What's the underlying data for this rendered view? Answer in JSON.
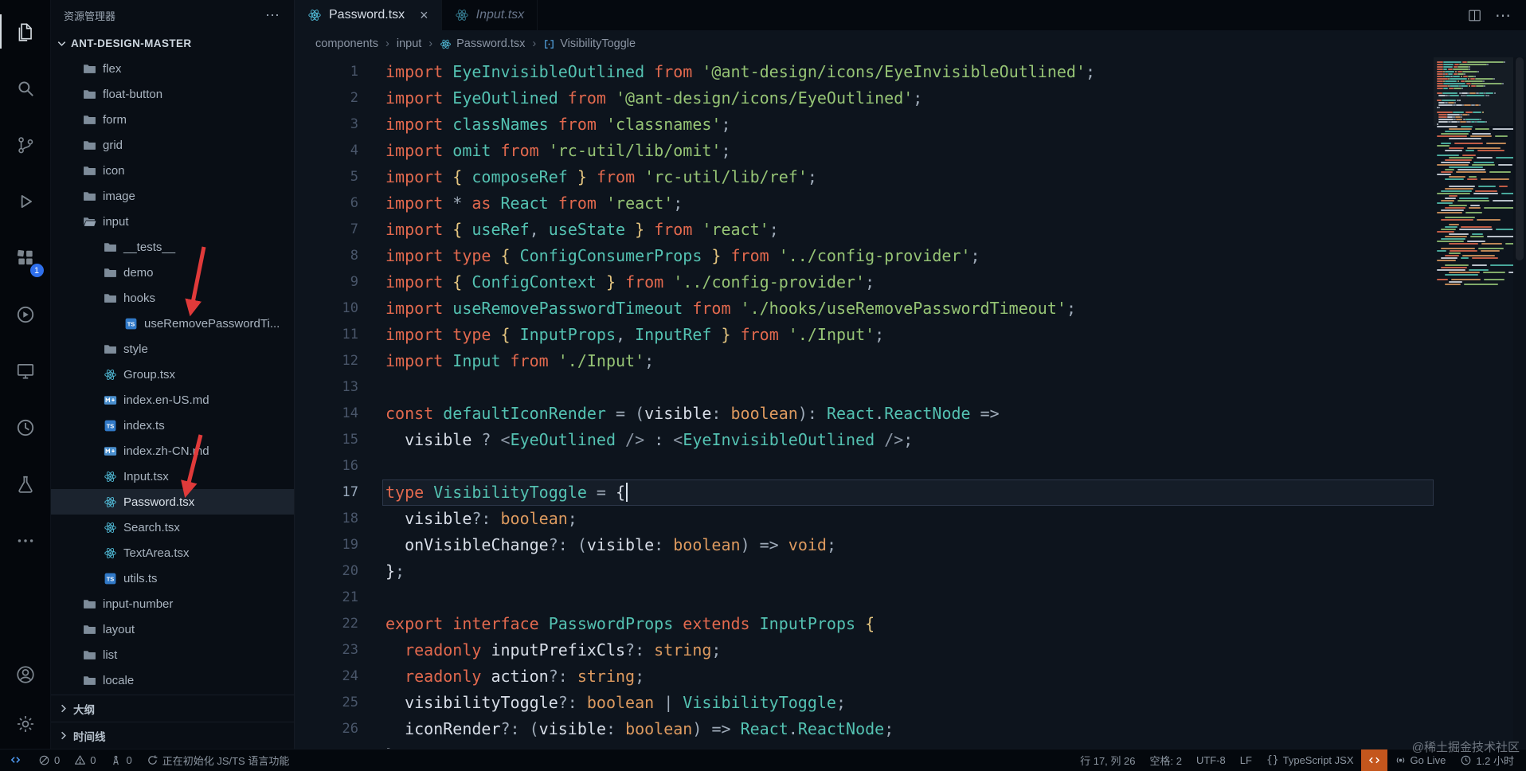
{
  "ui_colors": {
    "badge": "#2f6feb",
    "orange_badge": "#c4561d",
    "annotation_arrow": "#e03a3a",
    "remote_blue": "#4f9cf5",
    "react_icon": "#53c1de"
  },
  "activity_bar": {
    "items": [
      {
        "name": "explorer",
        "active": true
      },
      {
        "name": "search"
      },
      {
        "name": "source-control"
      },
      {
        "name": "run-and-debug"
      },
      {
        "name": "extensions",
        "badge": "1"
      },
      {
        "name": "tool-circle"
      },
      {
        "name": "remote-explorer"
      },
      {
        "name": "history"
      },
      {
        "name": "testing"
      },
      {
        "name": "more"
      }
    ],
    "bottom": [
      {
        "name": "account"
      },
      {
        "name": "settings"
      }
    ]
  },
  "sidebar": {
    "title": "资源管理器",
    "more_label": "⋯",
    "root_label": "ANT-DESIGN-MASTER",
    "tree": [
      {
        "label": "flex",
        "icon": "folder",
        "indent": 1
      },
      {
        "label": "float-button",
        "icon": "folder",
        "indent": 1
      },
      {
        "label": "form",
        "icon": "folder",
        "indent": 1
      },
      {
        "label": "grid",
        "icon": "folder",
        "indent": 1
      },
      {
        "label": "icon",
        "icon": "folder",
        "indent": 1
      },
      {
        "label": "image",
        "icon": "folder",
        "indent": 1
      },
      {
        "label": "input",
        "icon": "folder-open",
        "indent": 1
      },
      {
        "label": "__tests__",
        "icon": "folder",
        "indent": 2
      },
      {
        "label": "demo",
        "icon": "folder",
        "indent": 2
      },
      {
        "label": "hooks",
        "icon": "folder",
        "indent": 2
      },
      {
        "label": "useRemovePasswordTi...",
        "icon": "ts",
        "indent": 3
      },
      {
        "label": "style",
        "icon": "folder",
        "indent": 2
      },
      {
        "label": "Group.tsx",
        "icon": "react",
        "indent": 2
      },
      {
        "label": "index.en-US.md",
        "icon": "md",
        "indent": 2
      },
      {
        "label": "index.ts",
        "icon": "ts",
        "indent": 2
      },
      {
        "label": "index.zh-CN.md",
        "icon": "md",
        "indent": 2
      },
      {
        "label": "Input.tsx",
        "icon": "react",
        "indent": 2
      },
      {
        "label": "Password.tsx",
        "icon": "react",
        "indent": 2,
        "selected": true
      },
      {
        "label": "Search.tsx",
        "icon": "react",
        "indent": 2
      },
      {
        "label": "TextArea.tsx",
        "icon": "react",
        "indent": 2
      },
      {
        "label": "utils.ts",
        "icon": "ts",
        "indent": 2
      },
      {
        "label": "input-number",
        "icon": "folder",
        "indent": 1
      },
      {
        "label": "layout",
        "icon": "folder",
        "indent": 1
      },
      {
        "label": "list",
        "icon": "folder",
        "indent": 1
      },
      {
        "label": "locale",
        "icon": "folder",
        "indent": 1
      }
    ],
    "annotation_arrows": [
      {
        "from": "192 310",
        "to": "176 390"
      },
      {
        "from": "188 546",
        "to": "170 618"
      }
    ],
    "bottom_sections": [
      {
        "label": "大纲",
        "name": "outline-section"
      },
      {
        "label": "时间线",
        "name": "timeline-section"
      }
    ]
  },
  "editor": {
    "tabs": [
      {
        "label": "Password.tsx",
        "icon": "react",
        "active": true,
        "close_label": "×"
      },
      {
        "label": "Input.tsx",
        "icon": "react",
        "italic": true
      }
    ],
    "breadcrumbs": [
      {
        "label": "components"
      },
      {
        "label": "input"
      },
      {
        "label": "Password.tsx",
        "icon": "react"
      },
      {
        "label": "VisibilityToggle",
        "icon": "symbol"
      }
    ],
    "code": {
      "current_line": 17,
      "cursor_line": 17,
      "palette": {
        "kw": "#e2694e",
        "id": "#54c2b2",
        "str": "#96c475",
        "ty": "#dd9a5f",
        "br": "#e3c47f",
        "pu": "#9fabb9",
        "wh": "#d8dee8",
        "ag": "#8a95a3"
      },
      "lines": [
        [
          [
            "kw",
            "import "
          ],
          [
            "id",
            "EyeInvisibleOutlined"
          ],
          [
            "kw",
            " from "
          ],
          [
            "str",
            "'@ant-design/icons/EyeInvisibleOutlined'"
          ],
          [
            "pu",
            ";"
          ]
        ],
        [
          [
            "kw",
            "import "
          ],
          [
            "id",
            "EyeOutlined"
          ],
          [
            "kw",
            " from "
          ],
          [
            "str",
            "'@ant-design/icons/EyeOutlined'"
          ],
          [
            "pu",
            ";"
          ]
        ],
        [
          [
            "kw",
            "import "
          ],
          [
            "id",
            "classNames"
          ],
          [
            "kw",
            " from "
          ],
          [
            "str",
            "'classnames'"
          ],
          [
            "pu",
            ";"
          ]
        ],
        [
          [
            "kw",
            "import "
          ],
          [
            "id",
            "omit"
          ],
          [
            "kw",
            " from "
          ],
          [
            "str",
            "'rc-util/lib/omit'"
          ],
          [
            "pu",
            ";"
          ]
        ],
        [
          [
            "kw",
            "import "
          ],
          [
            "br",
            "{ "
          ],
          [
            "id",
            "composeRef"
          ],
          [
            "br",
            " }"
          ],
          [
            "kw",
            " from "
          ],
          [
            "str",
            "'rc-util/lib/ref'"
          ],
          [
            "pu",
            ";"
          ]
        ],
        [
          [
            "kw",
            "import "
          ],
          [
            "pu",
            "* "
          ],
          [
            "kw",
            "as "
          ],
          [
            "id",
            "React"
          ],
          [
            "kw",
            " from "
          ],
          [
            "str",
            "'react'"
          ],
          [
            "pu",
            ";"
          ]
        ],
        [
          [
            "kw",
            "import "
          ],
          [
            "br",
            "{ "
          ],
          [
            "id",
            "useRef"
          ],
          [
            "pu",
            ", "
          ],
          [
            "id",
            "useState"
          ],
          [
            "br",
            " }"
          ],
          [
            "kw",
            " from "
          ],
          [
            "str",
            "'react'"
          ],
          [
            "pu",
            ";"
          ]
        ],
        [
          [
            "kw",
            "import type "
          ],
          [
            "br",
            "{ "
          ],
          [
            "id",
            "ConfigConsumerProps"
          ],
          [
            "br",
            " }"
          ],
          [
            "kw",
            " from "
          ],
          [
            "str",
            "'../config-provider'"
          ],
          [
            "pu",
            ";"
          ]
        ],
        [
          [
            "kw",
            "import "
          ],
          [
            "br",
            "{ "
          ],
          [
            "id",
            "ConfigContext"
          ],
          [
            "br",
            " }"
          ],
          [
            "kw",
            " from "
          ],
          [
            "str",
            "'../config-provider'"
          ],
          [
            "pu",
            ";"
          ]
        ],
        [
          [
            "kw",
            "import "
          ],
          [
            "id",
            "useRemovePasswordTimeout"
          ],
          [
            "kw",
            " from "
          ],
          [
            "str",
            "'./hooks/useRemovePasswordTimeout'"
          ],
          [
            "pu",
            ";"
          ]
        ],
        [
          [
            "kw",
            "import type "
          ],
          [
            "br",
            "{ "
          ],
          [
            "id",
            "InputProps"
          ],
          [
            "pu",
            ", "
          ],
          [
            "id",
            "InputRef"
          ],
          [
            "br",
            " }"
          ],
          [
            "kw",
            " from "
          ],
          [
            "str",
            "'./Input'"
          ],
          [
            "pu",
            ";"
          ]
        ],
        [
          [
            "kw",
            "import "
          ],
          [
            "id",
            "Input"
          ],
          [
            "kw",
            " from "
          ],
          [
            "str",
            "'./Input'"
          ],
          [
            "pu",
            ";"
          ]
        ],
        [],
        [
          [
            "kw",
            "const "
          ],
          [
            "id",
            "defaultIconRender"
          ],
          [
            "pu",
            " = ("
          ],
          [
            "wh",
            "visible"
          ],
          [
            "pu",
            ": "
          ],
          [
            "ty",
            "boolean"
          ],
          [
            "pu",
            "): "
          ],
          [
            "id",
            "React"
          ],
          [
            "pu",
            "."
          ],
          [
            "id",
            "ReactNode"
          ],
          [
            "pu",
            " =>"
          ]
        ],
        [
          [
            "wh",
            "  visible "
          ],
          [
            "pu",
            "? "
          ],
          [
            "ag",
            "<"
          ],
          [
            "id",
            "EyeOutlined"
          ],
          [
            "ag",
            " /> "
          ],
          [
            "pu",
            ": "
          ],
          [
            "ag",
            "<"
          ],
          [
            "id",
            "EyeInvisibleOutlined"
          ],
          [
            "ag",
            " />"
          ],
          [
            "pu",
            ";"
          ]
        ],
        [],
        [
          [
            "kw",
            "type "
          ],
          [
            "id",
            "VisibilityToggle"
          ],
          [
            "pu",
            " = "
          ],
          [
            "wh",
            "{"
          ]
        ],
        [
          [
            "wh",
            "  visible"
          ],
          [
            "pu",
            "?: "
          ],
          [
            "ty",
            "boolean"
          ],
          [
            "pu",
            ";"
          ]
        ],
        [
          [
            "wh",
            "  onVisibleChange"
          ],
          [
            "pu",
            "?: ("
          ],
          [
            "wh",
            "visible"
          ],
          [
            "pu",
            ": "
          ],
          [
            "ty",
            "boolean"
          ],
          [
            "pu",
            ") => "
          ],
          [
            "ty",
            "void"
          ],
          [
            "pu",
            ";"
          ]
        ],
        [
          [
            "wh",
            "}"
          ],
          [
            "pu",
            ";"
          ]
        ],
        [],
        [
          [
            "kw",
            "export interface "
          ],
          [
            "id",
            "PasswordProps"
          ],
          [
            "kw",
            " extends "
          ],
          [
            "id",
            "InputProps"
          ],
          [
            "br",
            " {"
          ]
        ],
        [
          [
            "kw",
            "  readonly "
          ],
          [
            "wh",
            "inputPrefixCls"
          ],
          [
            "pu",
            "?: "
          ],
          [
            "ty",
            "string"
          ],
          [
            "pu",
            ";"
          ]
        ],
        [
          [
            "kw",
            "  readonly "
          ],
          [
            "wh",
            "action"
          ],
          [
            "pu",
            "?: "
          ],
          [
            "ty",
            "string"
          ],
          [
            "pu",
            ";"
          ]
        ],
        [
          [
            "wh",
            "  visibilityToggle"
          ],
          [
            "pu",
            "?: "
          ],
          [
            "ty",
            "boolean"
          ],
          [
            "pu",
            " | "
          ],
          [
            "id",
            "VisibilityToggle"
          ],
          [
            "pu",
            ";"
          ]
        ],
        [
          [
            "wh",
            "  iconRender"
          ],
          [
            "pu",
            "?: ("
          ],
          [
            "wh",
            "visible"
          ],
          [
            "pu",
            ": "
          ],
          [
            "ty",
            "boolean"
          ],
          [
            "pu",
            ") => "
          ],
          [
            "id",
            "React"
          ],
          [
            "pu",
            "."
          ],
          [
            "id",
            "ReactNode"
          ],
          [
            "pu",
            ";"
          ]
        ],
        [
          [
            "wh",
            "}"
          ]
        ]
      ]
    }
  },
  "status_bar": {
    "left": [
      {
        "name": "remote-indicator",
        "icon": "remote",
        "remote": true
      },
      {
        "name": "problems-errors",
        "icon": "error",
        "label": "0"
      },
      {
        "name": "problems-warnings",
        "icon": "warning",
        "label": "0"
      },
      {
        "name": "ports",
        "icon": "tower",
        "label": "0"
      },
      {
        "name": "language-status",
        "icon": "sync",
        "label": "正在初始化 JS/TS 语言功能"
      }
    ],
    "right": [
      {
        "name": "cursor-position",
        "label": "行 17, 列 26"
      },
      {
        "name": "indentation",
        "label": "空格: 2"
      },
      {
        "name": "encoding",
        "label": "UTF-8"
      },
      {
        "name": "eol",
        "label": "LF"
      },
      {
        "name": "language-mode",
        "icon": "braces",
        "label": "TypeScript JSX"
      },
      {
        "name": "extension-badge",
        "icon": "code",
        "accent": true
      },
      {
        "name": "go-live",
        "icon": "broadcast",
        "label": "Go Live"
      },
      {
        "name": "time-tracker",
        "icon": "clock",
        "label": "1.2 小时"
      }
    ]
  },
  "watermark": "@稀土掘金技术社区"
}
